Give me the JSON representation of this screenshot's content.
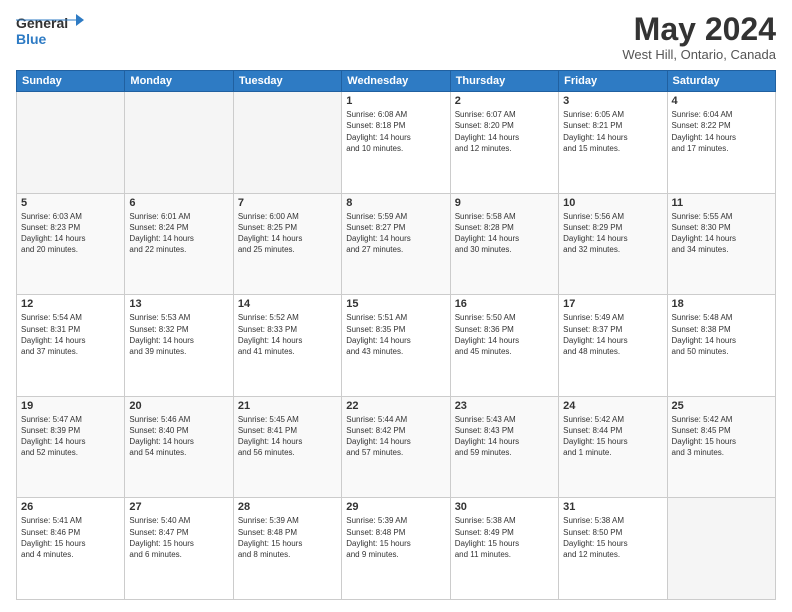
{
  "logo": {
    "line1": "General",
    "line2": "Blue"
  },
  "title": "May 2024",
  "location": "West Hill, Ontario, Canada",
  "days_of_week": [
    "Sunday",
    "Monday",
    "Tuesday",
    "Wednesday",
    "Thursday",
    "Friday",
    "Saturday"
  ],
  "weeks": [
    [
      {
        "day": "",
        "info": ""
      },
      {
        "day": "",
        "info": ""
      },
      {
        "day": "",
        "info": ""
      },
      {
        "day": "1",
        "info": "Sunrise: 6:08 AM\nSunset: 8:18 PM\nDaylight: 14 hours\nand 10 minutes."
      },
      {
        "day": "2",
        "info": "Sunrise: 6:07 AM\nSunset: 8:20 PM\nDaylight: 14 hours\nand 12 minutes."
      },
      {
        "day": "3",
        "info": "Sunrise: 6:05 AM\nSunset: 8:21 PM\nDaylight: 14 hours\nand 15 minutes."
      },
      {
        "day": "4",
        "info": "Sunrise: 6:04 AM\nSunset: 8:22 PM\nDaylight: 14 hours\nand 17 minutes."
      }
    ],
    [
      {
        "day": "5",
        "info": "Sunrise: 6:03 AM\nSunset: 8:23 PM\nDaylight: 14 hours\nand 20 minutes."
      },
      {
        "day": "6",
        "info": "Sunrise: 6:01 AM\nSunset: 8:24 PM\nDaylight: 14 hours\nand 22 minutes."
      },
      {
        "day": "7",
        "info": "Sunrise: 6:00 AM\nSunset: 8:25 PM\nDaylight: 14 hours\nand 25 minutes."
      },
      {
        "day": "8",
        "info": "Sunrise: 5:59 AM\nSunset: 8:27 PM\nDaylight: 14 hours\nand 27 minutes."
      },
      {
        "day": "9",
        "info": "Sunrise: 5:58 AM\nSunset: 8:28 PM\nDaylight: 14 hours\nand 30 minutes."
      },
      {
        "day": "10",
        "info": "Sunrise: 5:56 AM\nSunset: 8:29 PM\nDaylight: 14 hours\nand 32 minutes."
      },
      {
        "day": "11",
        "info": "Sunrise: 5:55 AM\nSunset: 8:30 PM\nDaylight: 14 hours\nand 34 minutes."
      }
    ],
    [
      {
        "day": "12",
        "info": "Sunrise: 5:54 AM\nSunset: 8:31 PM\nDaylight: 14 hours\nand 37 minutes."
      },
      {
        "day": "13",
        "info": "Sunrise: 5:53 AM\nSunset: 8:32 PM\nDaylight: 14 hours\nand 39 minutes."
      },
      {
        "day": "14",
        "info": "Sunrise: 5:52 AM\nSunset: 8:33 PM\nDaylight: 14 hours\nand 41 minutes."
      },
      {
        "day": "15",
        "info": "Sunrise: 5:51 AM\nSunset: 8:35 PM\nDaylight: 14 hours\nand 43 minutes."
      },
      {
        "day": "16",
        "info": "Sunrise: 5:50 AM\nSunset: 8:36 PM\nDaylight: 14 hours\nand 45 minutes."
      },
      {
        "day": "17",
        "info": "Sunrise: 5:49 AM\nSunset: 8:37 PM\nDaylight: 14 hours\nand 48 minutes."
      },
      {
        "day": "18",
        "info": "Sunrise: 5:48 AM\nSunset: 8:38 PM\nDaylight: 14 hours\nand 50 minutes."
      }
    ],
    [
      {
        "day": "19",
        "info": "Sunrise: 5:47 AM\nSunset: 8:39 PM\nDaylight: 14 hours\nand 52 minutes."
      },
      {
        "day": "20",
        "info": "Sunrise: 5:46 AM\nSunset: 8:40 PM\nDaylight: 14 hours\nand 54 minutes."
      },
      {
        "day": "21",
        "info": "Sunrise: 5:45 AM\nSunset: 8:41 PM\nDaylight: 14 hours\nand 56 minutes."
      },
      {
        "day": "22",
        "info": "Sunrise: 5:44 AM\nSunset: 8:42 PM\nDaylight: 14 hours\nand 57 minutes."
      },
      {
        "day": "23",
        "info": "Sunrise: 5:43 AM\nSunset: 8:43 PM\nDaylight: 14 hours\nand 59 minutes."
      },
      {
        "day": "24",
        "info": "Sunrise: 5:42 AM\nSunset: 8:44 PM\nDaylight: 15 hours\nand 1 minute."
      },
      {
        "day": "25",
        "info": "Sunrise: 5:42 AM\nSunset: 8:45 PM\nDaylight: 15 hours\nand 3 minutes."
      }
    ],
    [
      {
        "day": "26",
        "info": "Sunrise: 5:41 AM\nSunset: 8:46 PM\nDaylight: 15 hours\nand 4 minutes."
      },
      {
        "day": "27",
        "info": "Sunrise: 5:40 AM\nSunset: 8:47 PM\nDaylight: 15 hours\nand 6 minutes."
      },
      {
        "day": "28",
        "info": "Sunrise: 5:39 AM\nSunset: 8:48 PM\nDaylight: 15 hours\nand 8 minutes."
      },
      {
        "day": "29",
        "info": "Sunrise: 5:39 AM\nSunset: 8:48 PM\nDaylight: 15 hours\nand 9 minutes."
      },
      {
        "day": "30",
        "info": "Sunrise: 5:38 AM\nSunset: 8:49 PM\nDaylight: 15 hours\nand 11 minutes."
      },
      {
        "day": "31",
        "info": "Sunrise: 5:38 AM\nSunset: 8:50 PM\nDaylight: 15 hours\nand 12 minutes."
      },
      {
        "day": "",
        "info": ""
      }
    ]
  ]
}
